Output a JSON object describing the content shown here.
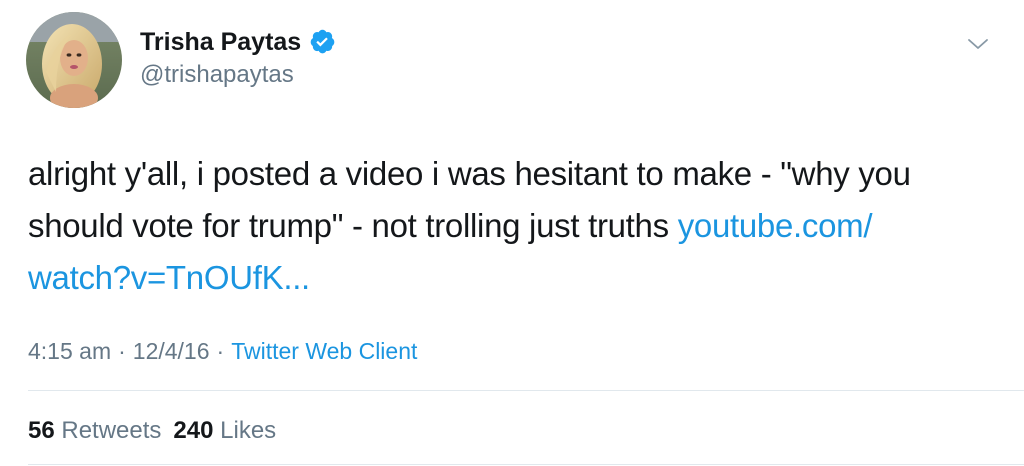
{
  "author": {
    "name": "Trisha Paytas",
    "handle": "@trishapaytas",
    "verified": true
  },
  "tweet": {
    "text_lines": [
      "alright y'all, i posted a video i was hesitant to make - \"why you",
      "should vote for trump\" - not trolling just truths "
    ],
    "link_part1": "youtube.com/",
    "link_part2": "watch?v=TnOUfK..."
  },
  "meta": {
    "time": "4:15 am",
    "separator": "·",
    "date": "12/4/16",
    "client": "Twitter Web Client"
  },
  "stats": {
    "retweets_count": "56",
    "retweets_label": "Retweets",
    "likes_count": "240",
    "likes_label": "Likes"
  },
  "icons": {
    "verified": "verified-badge-icon",
    "more": "chevron-down-icon"
  },
  "colors": {
    "link": "#1b95e0",
    "secondary_text": "#657786",
    "primary_text": "#14171a",
    "verified": "#1da1f2"
  }
}
